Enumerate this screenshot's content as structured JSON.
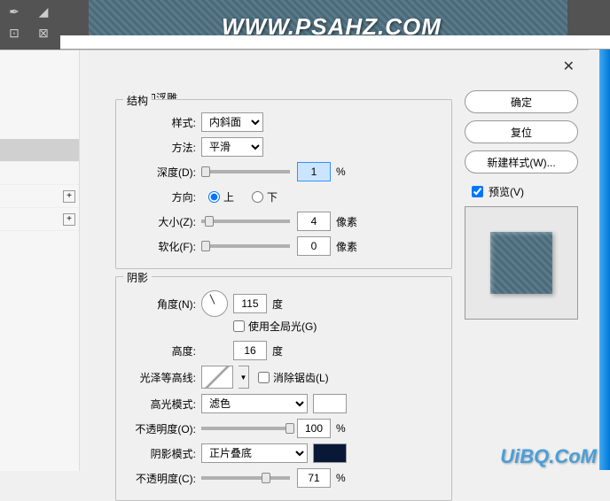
{
  "watermark": "WWW.PSAHZ.COM",
  "watermark2": "UiBQ.CoM",
  "panel": {
    "section_title": "斜面和浮雕",
    "structure": {
      "title": "结构",
      "style_label": "样式:",
      "style_value": "内斜面",
      "method_label": "方法:",
      "method_value": "平滑",
      "depth_label": "深度(D):",
      "depth_value": "1",
      "depth_unit": "%",
      "direction_label": "方向:",
      "dir_up": "上",
      "dir_down": "下",
      "size_label": "大小(Z):",
      "size_value": "4",
      "size_unit": "像素",
      "soften_label": "软化(F):",
      "soften_value": "0",
      "soften_unit": "像素"
    },
    "shading": {
      "title": "阴影",
      "angle_label": "角度(N):",
      "angle_value": "115",
      "angle_unit": "度",
      "global_light": "使用全局光(G)",
      "altitude_label": "高度:",
      "altitude_value": "16",
      "altitude_unit": "度",
      "gloss_label": "光泽等高线:",
      "antialias": "消除锯齿(L)",
      "highlight_mode_label": "高光模式:",
      "highlight_mode_value": "滤色",
      "highlight_color": "#ffffff",
      "highlight_opacity_label": "不透明度(O):",
      "highlight_opacity_value": "100",
      "highlight_opacity_unit": "%",
      "shadow_mode_label": "阴影模式:",
      "shadow_mode_value": "正片叠底",
      "shadow_color": "#0a1838",
      "shadow_opacity_label": "不透明度(C):",
      "shadow_opacity_value": "71",
      "shadow_opacity_unit": "%"
    }
  },
  "buttons": {
    "ok": "确定",
    "reset": "复位",
    "new_style": "新建样式(W)...",
    "preview": "预览(V)"
  }
}
